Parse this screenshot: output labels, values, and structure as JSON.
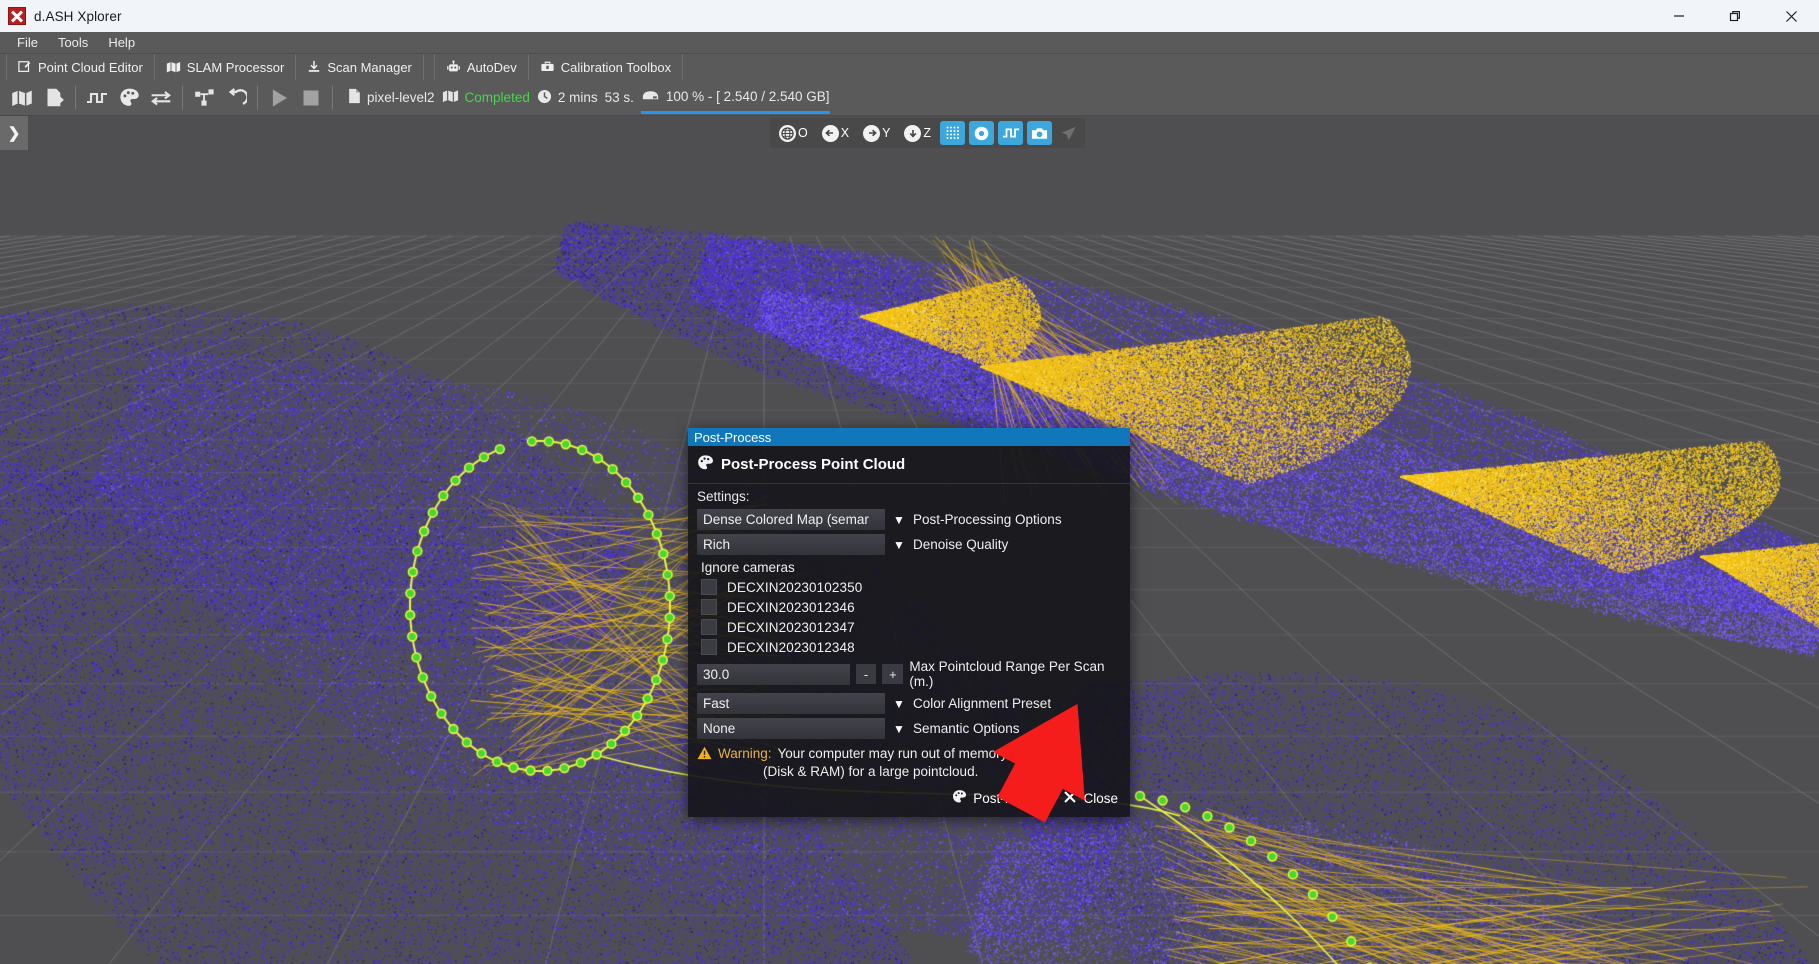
{
  "window": {
    "title": "d.ASH Xplorer",
    "app_icon": "app-logo-icon",
    "minimize": "—",
    "maximize": "❐",
    "close": "✕"
  },
  "menubar": {
    "items": [
      "File",
      "Tools",
      "Help"
    ]
  },
  "modulebar": {
    "items": [
      {
        "label": "Point Cloud Editor",
        "icon": "edit-map-icon"
      },
      {
        "label": "SLAM Processor",
        "icon": "map-icon"
      },
      {
        "label": "Scan Manager",
        "icon": "download-icon"
      },
      {
        "label": "AutoDev",
        "icon": "robot-icon"
      },
      {
        "label": "Calibration Toolbox",
        "icon": "toolbox-icon"
      }
    ]
  },
  "toolbar": {
    "buttons": [
      {
        "name": "map-button",
        "icon": "map-icon"
      },
      {
        "name": "export-button",
        "icon": "file-export-icon"
      },
      {
        "name": "signal-button",
        "icon": "square-wave-icon"
      },
      {
        "name": "palette-button",
        "icon": "palette-icon"
      },
      {
        "name": "swap-button",
        "icon": "transfer-arrows-icon"
      },
      {
        "name": "graph-button",
        "icon": "node-tree-icon"
      },
      {
        "name": "undo-button",
        "icon": "undo-icon"
      },
      {
        "name": "play-button",
        "icon": "play-icon"
      },
      {
        "name": "stop-button",
        "icon": "stop-icon"
      }
    ],
    "status": {
      "file_icon": "file-icon",
      "file_name": "pixel-level2",
      "map_icon": "map-icon",
      "state": "Completed",
      "clock_icon": "clock-icon",
      "elapsed_minutes": "2 mins",
      "elapsed_seconds": "53 s.",
      "disk_icon": "disk-icon",
      "memory": "100 % - [ 2.540 / 2.540 GB]",
      "progress_percent": 100
    }
  },
  "viewport": {
    "panel_toggle": "❯",
    "viewbar": {
      "origin": {
        "label": "O",
        "icon": "globe-icon"
      },
      "axis_x": {
        "label": "X",
        "icon": "arrow-left-icon"
      },
      "axis_y": {
        "label": "Y",
        "icon": "arrow-right-icon"
      },
      "axis_z": {
        "label": "Z",
        "icon": "arrow-down-icon"
      },
      "toggles": [
        {
          "name": "grid-toggle",
          "icon": "grid-dots-icon",
          "active": true
        },
        {
          "name": "point-toggle",
          "icon": "circle-dot-icon",
          "active": true
        },
        {
          "name": "trajectory-toggle",
          "icon": "square-wave-icon",
          "active": true
        },
        {
          "name": "camera-toggle",
          "icon": "camera-icon",
          "active": true
        },
        {
          "name": "send-toggle",
          "icon": "paper-plane-icon",
          "active": false
        }
      ]
    }
  },
  "dialog": {
    "titlebar": "Post-Process",
    "header": "Post-Process Point Cloud",
    "header_icon": "palette-icon",
    "settings_label": "Settings:",
    "fields": [
      {
        "value": "Dense Colored Map (semar",
        "label": "Post-Processing Options",
        "control": "dropdown"
      },
      {
        "value": "Rich",
        "label": "Denoise Quality",
        "control": "dropdown"
      }
    ],
    "cameras_label": "Ignore cameras",
    "cameras": [
      {
        "name": "DECXIN20230102350",
        "checked": false
      },
      {
        "name": "DECXIN2023012346",
        "checked": false
      },
      {
        "name": "DECXIN2023012347",
        "checked": false
      },
      {
        "name": "DECXIN2023012348",
        "checked": false
      }
    ],
    "range": {
      "value": "30.0",
      "minus": "-",
      "plus": "+",
      "label": "Max Pointcloud Range Per Scan (m.)"
    },
    "fields2": [
      {
        "value": "Fast",
        "label": "Color Alignment Preset",
        "control": "dropdown"
      },
      {
        "value": "None",
        "label": "Semantic Options",
        "control": "dropdown"
      }
    ],
    "warning": {
      "icon": "warning-triangle-icon",
      "key": "Warning:",
      "line1": "Your computer may run out of memory",
      "line2": "(Disk & RAM) for a large pointcloud."
    },
    "footer": {
      "primary": {
        "label": "Post-Process",
        "icon": "palette-icon"
      },
      "secondary": {
        "label": "Close",
        "icon": "close-x-icon"
      }
    }
  },
  "annotation": {
    "arrow_color": "#f51c1c",
    "name": "red-arrow-annotation"
  },
  "colors": {
    "accent": "#1177bb",
    "toggle_on": "#3ba7dd",
    "ok_green": "#49d64a",
    "warn_yellow": "#e8b33a",
    "progress": "#2196f3"
  }
}
